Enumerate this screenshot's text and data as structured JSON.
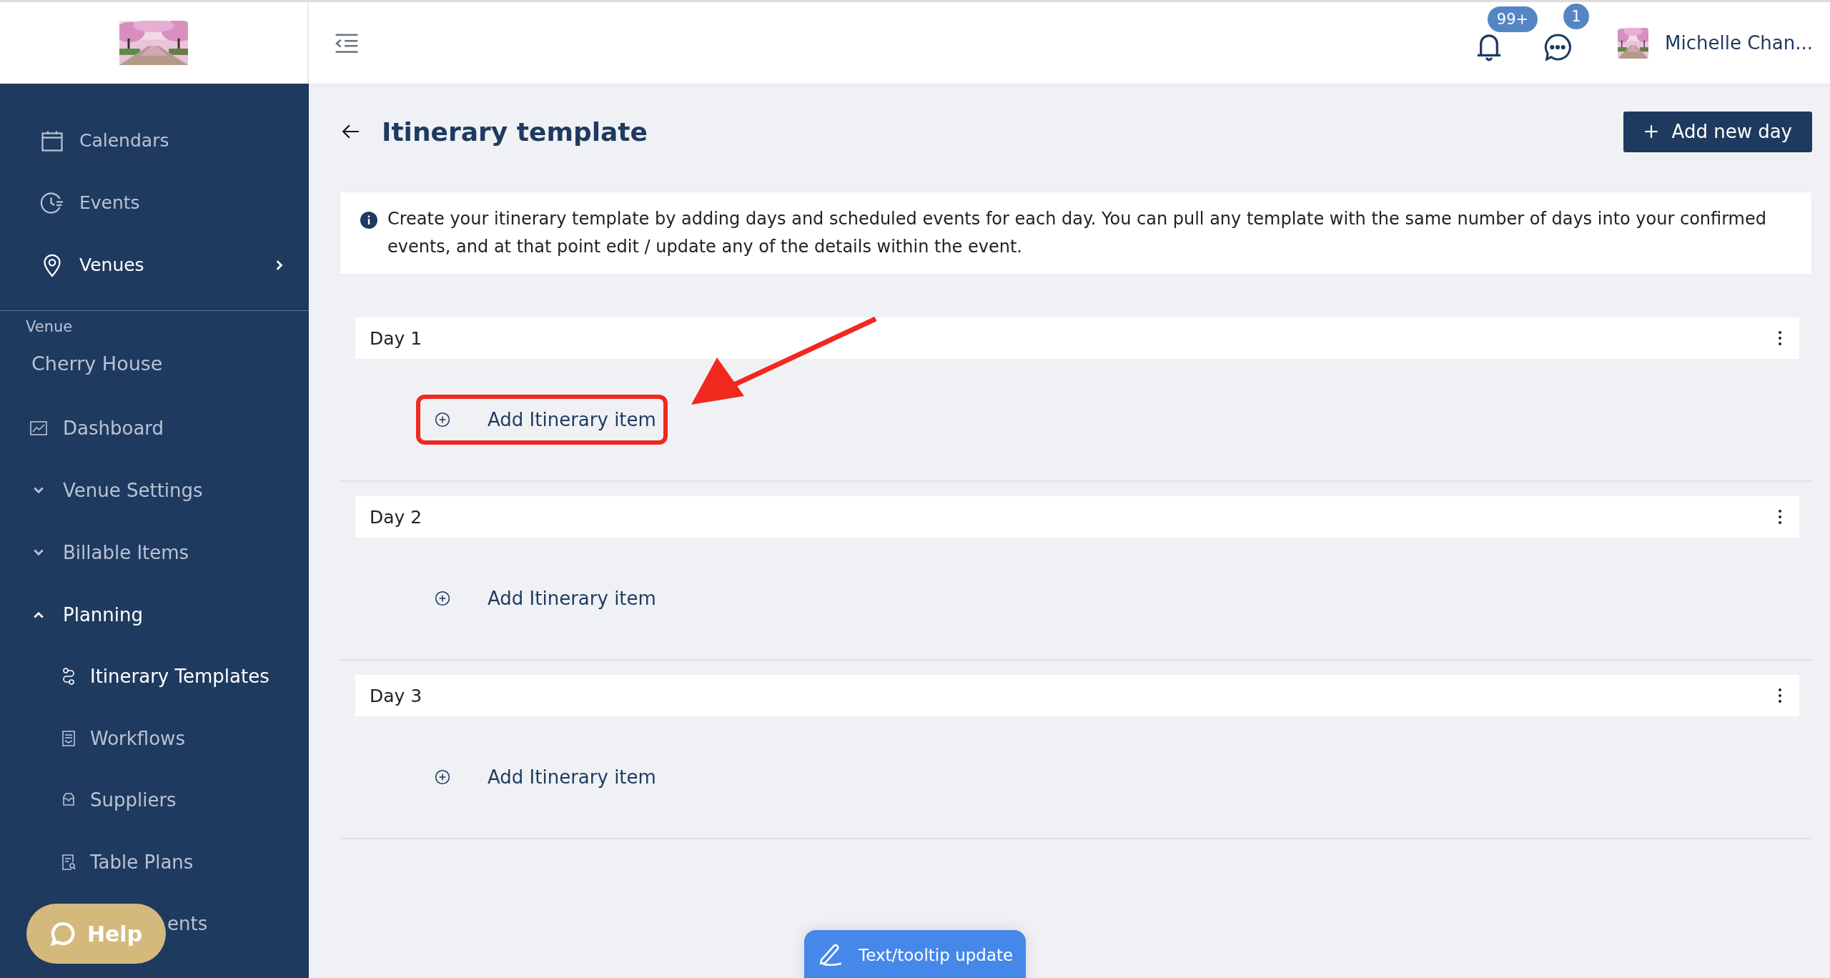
{
  "topbar": {
    "notifications_badge": "99+",
    "messages_badge": "1",
    "user_name": "Michelle Chan..."
  },
  "sidebar": {
    "nav": [
      {
        "label": "Calendars",
        "selected": false
      },
      {
        "label": "Events",
        "selected": false
      },
      {
        "label": "Venues",
        "selected": true
      }
    ],
    "venue_heading": "Venue",
    "venue_name": "Cherry House",
    "venue_menu": [
      {
        "kind": "link",
        "label": "Dashboard"
      },
      {
        "kind": "group",
        "label": "Venue Settings",
        "expanded": false
      },
      {
        "kind": "group",
        "label": "Billable Items",
        "expanded": false
      },
      {
        "kind": "group",
        "label": "Planning",
        "expanded": true,
        "children": [
          {
            "kind": "link",
            "label": "Itinerary Templates",
            "selected": true
          },
          {
            "kind": "link",
            "label": "Workflows",
            "selected": false
          },
          {
            "kind": "link",
            "label": "Suppliers",
            "selected": false
          },
          {
            "kind": "link",
            "label": "Table Plans",
            "selected": false
          },
          {
            "kind": "clipped",
            "label": "ents",
            "selected": false
          }
        ]
      }
    ]
  },
  "page": {
    "title": "Itinerary template",
    "add_day_button": "Add new day",
    "info": "Create your itinerary template by adding days and scheduled events for each day. You can pull any template with the same number of days into your confirmed events, and at that point edit / update any of the details within the event.",
    "days": [
      {
        "label": "Day 1",
        "add_item": "Add Itinerary item",
        "highlighted": true
      },
      {
        "label": "Day 2",
        "add_item": "Add Itinerary item",
        "highlighted": false
      },
      {
        "label": "Day 3",
        "add_item": "Add Itinerary item",
        "highlighted": false
      }
    ]
  },
  "help_button": "Help",
  "feedback_button": "Text/tooltip update"
}
